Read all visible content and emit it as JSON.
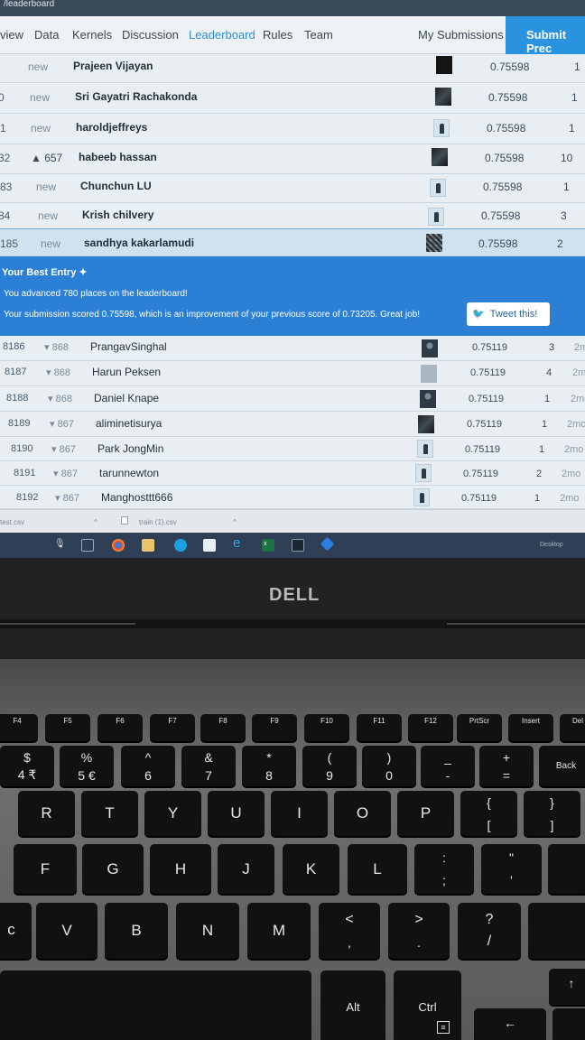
{
  "page_bar": "/leaderboard",
  "nav": {
    "tabs": [
      "view",
      "Data",
      "Kernels",
      "Discussion",
      "Leaderboard",
      "Rules",
      "Team"
    ],
    "my_submissions": "My Submissions",
    "submit": "Submit Prec"
  },
  "top_rows": [
    {
      "rank": "",
      "change": "new",
      "name": "Prajeen Vijayan",
      "score": "0.75598",
      "entries": "1"
    },
    {
      "rank": "0",
      "change": "new",
      "name": "Sri Gayatri Rachakonda",
      "score": "0.75598",
      "entries": "1"
    },
    {
      "rank": "1",
      "change": "new",
      "name": "haroldjeffreys",
      "score": "0.75598",
      "entries": "1"
    },
    {
      "rank": "32",
      "change": "▲ 657",
      "name": "habeeb hassan",
      "score": "0.75598",
      "entries": "10"
    },
    {
      "rank": "83",
      "change": "new",
      "name": "Chunchun LU",
      "score": "0.75598",
      "entries": "1"
    },
    {
      "rank": "84",
      "change": "new",
      "name": "Krish chilvery",
      "score": "0.75598",
      "entries": "3"
    },
    {
      "rank": "185",
      "change": "new",
      "name": "sandhya kakarlamudi",
      "score": "0.75598",
      "entries": "2"
    }
  ],
  "banner": {
    "title": "Your Best Entry ✦",
    "line1": "You advanced 780 places on the leaderboard!",
    "line2": "Your submission scored 0.75598, which is an improvement of your previous score of 0.73205. Great job!",
    "tweet": "Tweet this!"
  },
  "lower_rows": [
    {
      "rank": "8186",
      "change": "▾ 868",
      "name": "PrangavSinghal",
      "score": "0.75119",
      "entries": "3",
      "last": "2m"
    },
    {
      "rank": "8187",
      "change": "▾ 868",
      "name": "Harun Peksen",
      "score": "0.75119",
      "entries": "4",
      "last": "2m"
    },
    {
      "rank": "8188",
      "change": "▾ 868",
      "name": "Daniel Knape",
      "score": "0.75119",
      "entries": "1",
      "last": "2mo"
    },
    {
      "rank": "8189",
      "change": "▾ 867",
      "name": "aliminetisurya",
      "score": "0.75119",
      "entries": "1",
      "last": "2mo"
    },
    {
      "rank": "8190",
      "change": "▾ 867",
      "name": "Park JongMin",
      "score": "0.75119",
      "entries": "1",
      "last": "2mo"
    },
    {
      "rank": "8191",
      "change": "▾ 867",
      "name": "tarunnewton",
      "score": "0.75119",
      "entries": "2",
      "last": "2mo"
    },
    {
      "rank": "8192",
      "change": "▾ 867",
      "name": "Manghosttt666",
      "score": "0.75119",
      "entries": "1",
      "last": "2mo"
    }
  ],
  "downloads": {
    "file1": "test.csv",
    "file2": "train (1).csv"
  },
  "taskbar": {
    "desktop": "Desktop"
  },
  "bezel": {
    "logo": "DELL"
  },
  "keyboard": {
    "fn_row": [
      "F4",
      "F5",
      "F6",
      "F7",
      "F8",
      "F9",
      "F10",
      "F11",
      "F12",
      "PrtScr",
      "Insert",
      "Del"
    ],
    "num_row": [
      {
        "top": "$",
        "bottom": "4 ₹"
      },
      {
        "top": "%",
        "bottom": "5 €"
      },
      {
        "top": "^",
        "bottom": "6"
      },
      {
        "top": "&",
        "bottom": "7"
      },
      {
        "top": "*",
        "bottom": "8"
      },
      {
        "top": "(",
        "bottom": "9"
      },
      {
        "top": ")",
        "bottom": "0"
      },
      {
        "top": "_",
        "bottom": "-"
      },
      {
        "top": "+",
        "bottom": "="
      },
      {
        "top": "",
        "bottom": "Back"
      }
    ],
    "row_q": [
      "R",
      "T",
      "Y",
      "U",
      "I",
      "O",
      "P"
    ],
    "row_q_extra": [
      {
        "top": "{",
        "bottom": "["
      },
      {
        "top": "}",
        "bottom": "]"
      }
    ],
    "row_a": [
      "F",
      "G",
      "H",
      "J",
      "K",
      "L"
    ],
    "row_a_extra": [
      {
        "top": ":",
        "bottom": ";"
      },
      {
        "top": "\"",
        "bottom": "'"
      }
    ],
    "row_z": [
      "V",
      "B",
      "N",
      "M"
    ],
    "row_z_extra": [
      {
        "top": "<",
        "bottom": ","
      },
      {
        "top": ">",
        "bottom": "."
      },
      {
        "top": "?",
        "bottom": "/"
      }
    ],
    "bottom": {
      "alt": "Alt",
      "ctrl": "Ctrl"
    }
  }
}
